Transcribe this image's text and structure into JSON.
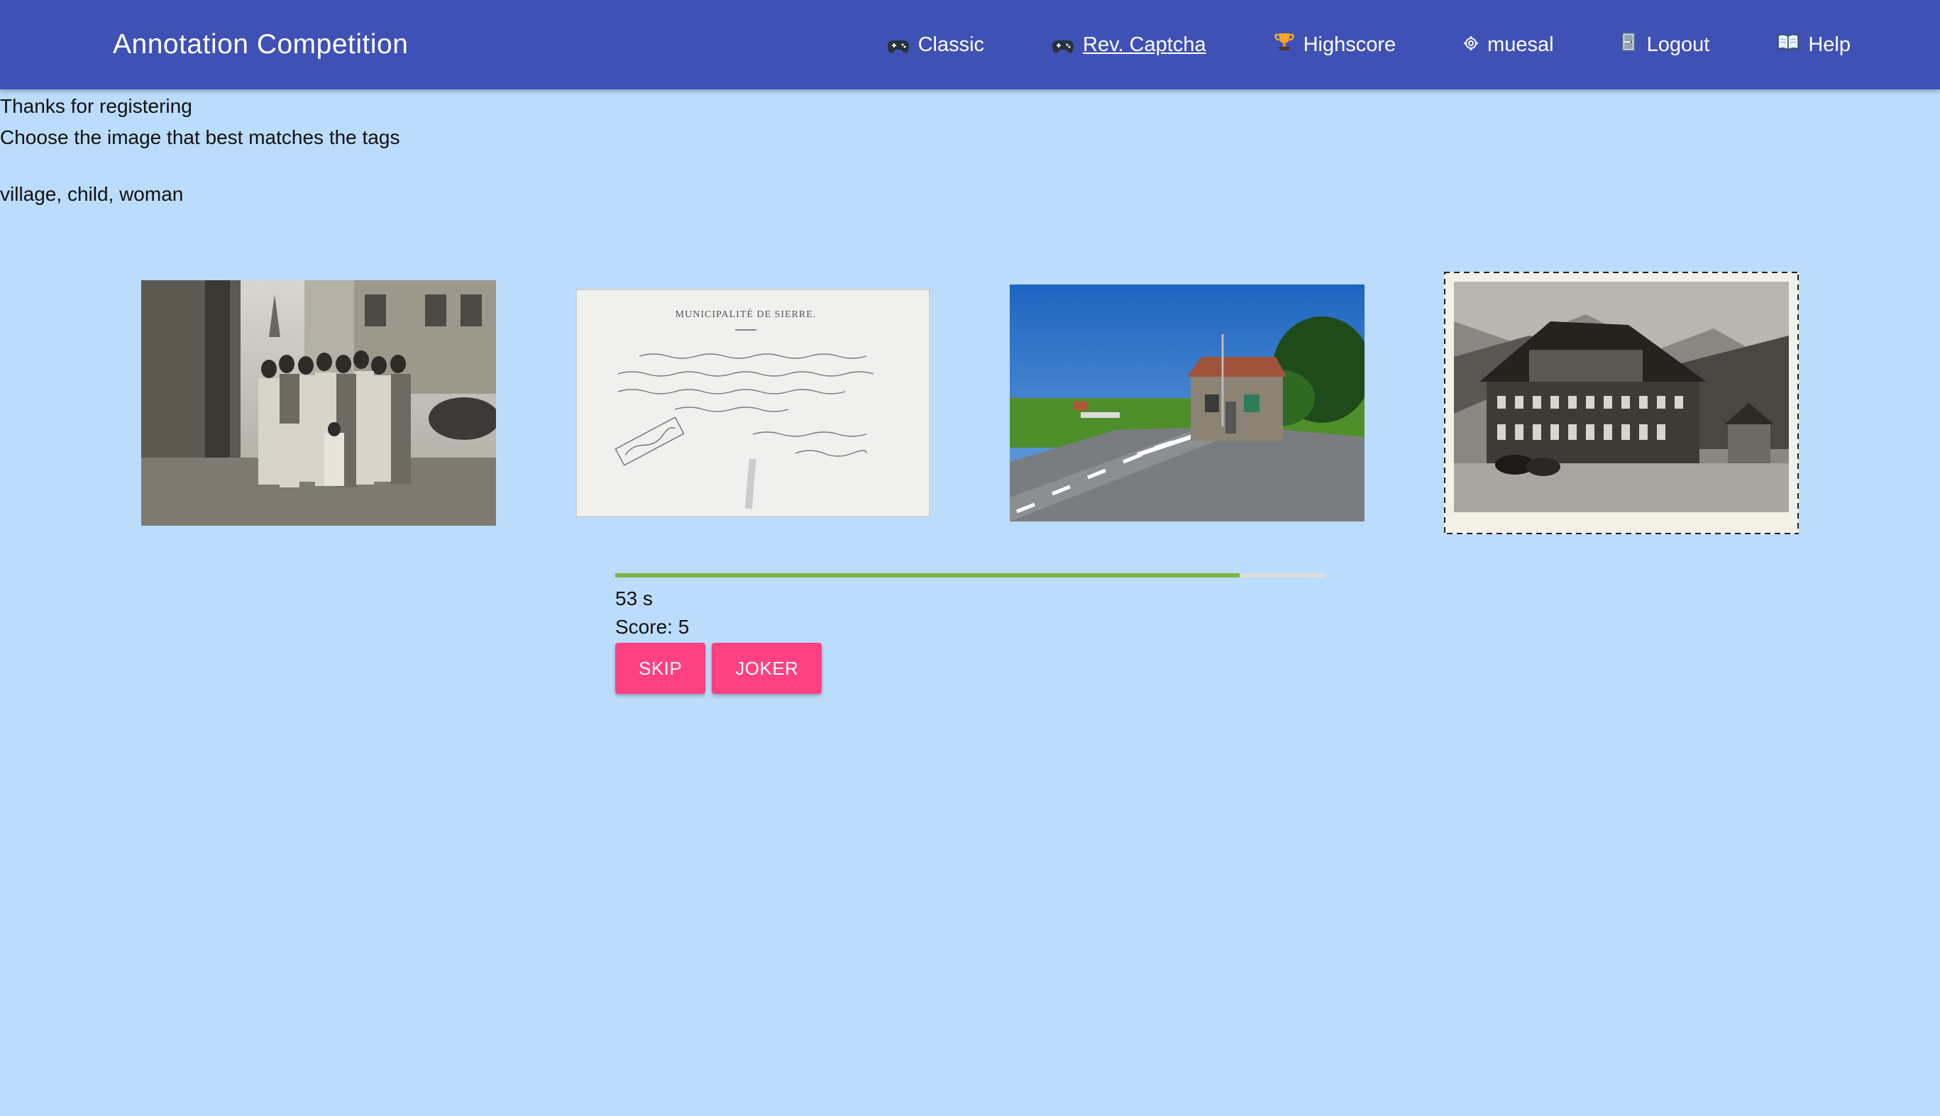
{
  "navbar": {
    "brand": "Annotation Competition",
    "items": [
      {
        "label": "Classic",
        "icon": "gamepad-icon",
        "active": false
      },
      {
        "label": "Rev. Captcha",
        "icon": "gamepad-icon",
        "active": true
      },
      {
        "label": "Highscore",
        "icon": "trophy-icon",
        "active": false
      },
      {
        "label": "muesal",
        "icon": "gear-icon",
        "active": false
      },
      {
        "label": "Logout",
        "icon": "exit-icon",
        "active": false
      },
      {
        "label": "Help",
        "icon": "book-icon",
        "active": false
      }
    ]
  },
  "intro": {
    "thanks": "Thanks for registering",
    "instruction": "Choose the image that best matches the tags",
    "tags": "village, child, woman"
  },
  "images": [
    {
      "name": "family-group-photo",
      "description_icon": "sepia-photo"
    },
    {
      "name": "handwritten-document-municipalite-de-sierre",
      "header_text": "MUNICIPALITÉ DE SIERRE."
    },
    {
      "name": "roadside-house-photo",
      "description_icon": "color-photo"
    },
    {
      "name": "chalet-hotel-postcard",
      "description_icon": "bw-postcard"
    }
  ],
  "game": {
    "progress": 0.88,
    "timer": "53 s",
    "score": "Score: 5",
    "skip_label": "SKIP",
    "joker_label": "JOKER"
  },
  "colors": {
    "navbar": "#3f51b5",
    "background": "#bbdcfb",
    "accent": "#ff4081",
    "progress": "#7cb342"
  }
}
